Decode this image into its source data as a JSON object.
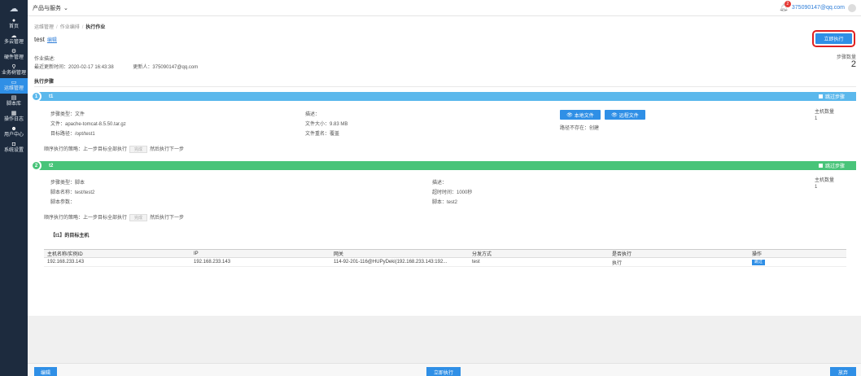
{
  "sidebar": {
    "items": [
      {
        "label": "首页",
        "icon": "home-icon"
      },
      {
        "label": "多云管理",
        "icon": "cloud-icon"
      },
      {
        "label": "硬件管理",
        "icon": "hardware-icon"
      },
      {
        "label": "业务树管理",
        "icon": "tree-icon"
      },
      {
        "label": "运维管理",
        "icon": "monitor-icon"
      },
      {
        "label": "脚本库",
        "icon": "script-icon"
      },
      {
        "label": "操作日志",
        "icon": "log-icon"
      },
      {
        "label": "用户中心",
        "icon": "user-icon"
      },
      {
        "label": "系统设置",
        "icon": "settings-icon"
      }
    ]
  },
  "topbar": {
    "product_menu": "产品与服务",
    "notification_count": "2",
    "user_email": "375090147@qq.com"
  },
  "breadcrumb": {
    "items": [
      "运维管理",
      "作业编排",
      "执行作业"
    ]
  },
  "job": {
    "name": "test",
    "edit_link": "编辑",
    "run_now": "立即执行",
    "desc_label": "作业描述:",
    "updated_time": "最近更新时间：2020-02-17 16:43:38",
    "updated_by": "更新人：375090147@qq.com",
    "step_count_label": "步骤数量",
    "step_count": "2",
    "section_title": "执行步骤"
  },
  "steps": [
    {
      "num": "1",
      "name": "t1",
      "skip_label": "跳过步骤",
      "type": "步骤类型：文件",
      "file": "文件：apache-tomcat-8.5.50.tar.gz",
      "target_path": "目标路径：/opt/test1",
      "desc": "描述：",
      "file_size": "文件大小：9.83 MB",
      "rename": "文件重名：覆盖",
      "local_file_btn": "本地文件",
      "remote_file_btn": "远程文件",
      "path_missing": "路径不存在：创建",
      "host_count_label": "主机数量",
      "host_count": "1",
      "strategy_prefix": "顺序执行的策略：上一步目标全部执行",
      "strategy_btn": "完成",
      "strategy_suffix": "然后执行下一步"
    },
    {
      "num": "2",
      "name": "t2",
      "skip_label": "跳过步骤",
      "type": "步骤类型：脚本",
      "script_name": "脚本名称：test/test2",
      "script_params": "脚本参数：",
      "desc": "描述：",
      "timeout": "超时时间：1000秒",
      "script": "脚本：test2",
      "host_count_label": "主机数量",
      "host_count": "1",
      "strategy_prefix": "顺序执行的策略：上一步目标全部执行",
      "strategy_btn": "完成",
      "strategy_suffix": "然后执行下一步"
    }
  ],
  "hosts": {
    "title": "【t1】的目标主机",
    "columns": [
      "主机名称/实例ID",
      "IP",
      "网关",
      "分发方式",
      "是否执行",
      "操作"
    ],
    "rows": [
      [
        "192.168.233.143",
        "192.168.233.143",
        "114-92-201-116@HUPyDeki(192.168.233.143:192...",
        "test",
        "执行",
        "跳过"
      ]
    ]
  },
  "footer": {
    "edit": "编辑",
    "run_now": "立即执行",
    "discard": "放弃"
  },
  "colors": {
    "primary": "#2f8fe6",
    "step1": "#5bb8ec",
    "step2": "#48c479",
    "sidebar_bg": "#1d2b3e",
    "highlight": "#e02020"
  }
}
